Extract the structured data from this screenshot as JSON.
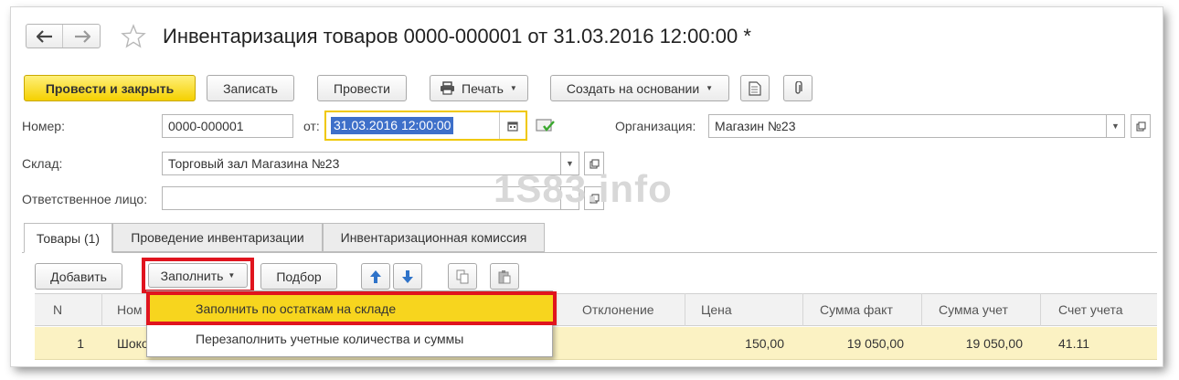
{
  "window": {
    "title": "Инвентаризация товаров 0000-000001 от 31.03.2016 12:00:00 *"
  },
  "toolbar": {
    "post_and_close": "Провести и закрыть",
    "save": "Записать",
    "post": "Провести",
    "print": "Печать",
    "create_based_on": "Создать на основании"
  },
  "form": {
    "number_label": "Номер:",
    "number_value": "0000-000001",
    "date_label": "от:",
    "date_value": "31.03.2016 12:00:00",
    "org_label": "Организация:",
    "org_value": "Магазин №23",
    "warehouse_label": "Склад:",
    "warehouse_value": "Торговый зал Магазина №23",
    "responsible_label": "Ответственное лицо:",
    "responsible_value": ""
  },
  "watermark": "1S83.info",
  "tabs": [
    {
      "label": "Товары (1)"
    },
    {
      "label": "Проведение инвентаризации"
    },
    {
      "label": "Инвентаризационная комиссия"
    }
  ],
  "table_toolbar": {
    "add": "Добавить",
    "fill": "Заполнить",
    "pick": "Подбор"
  },
  "fill_menu": {
    "items": [
      "Заполнить по остаткам на складе",
      "Перезаполнить учетные количества и суммы"
    ]
  },
  "table": {
    "columns": [
      "N",
      "Ном",
      "Отклонение",
      "Цена",
      "Сумма факт",
      "Сумма учет",
      "Счет учета"
    ],
    "rows": [
      {
        "n": "1",
        "name": "Шоко",
        "deviation": "",
        "price": "150,00",
        "sum_fact": "19 050,00",
        "sum_account": "19 050,00",
        "account": "41.11"
      }
    ]
  },
  "colors": {
    "primary_button": "#f5d000",
    "highlight_border": "#e0141e",
    "menu_selected": "#f7d51e",
    "row_selected": "#fbf2c3",
    "date_focus_border": "#f0c800"
  }
}
